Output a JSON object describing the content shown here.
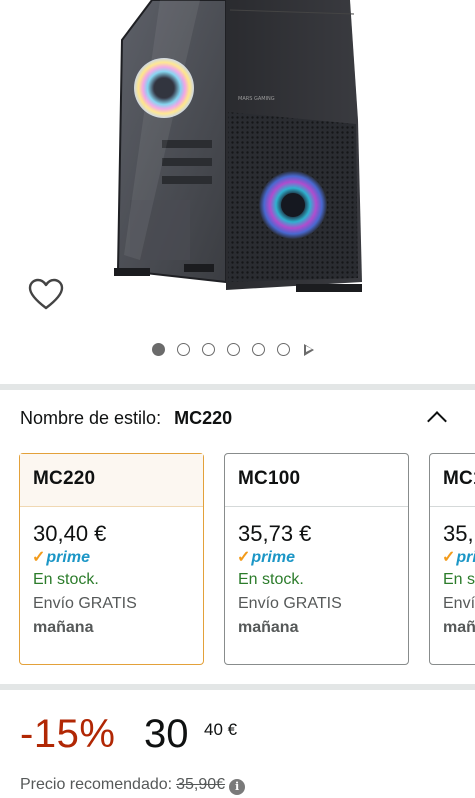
{
  "icons": {
    "wishlist": "heart-outline-icon",
    "collapse": "chevron-up-icon",
    "video": "play-icon",
    "info": "info-icon"
  },
  "colors": {
    "discount": "#B12704",
    "in_stock": "#2C7C2B",
    "prime_blue": "#1B96C6",
    "prime_check": "#F29B1B",
    "selected_border": "#E3A13A"
  },
  "gallery": {
    "image_count": 6,
    "active_index": 0,
    "has_video": true
  },
  "style_selector": {
    "label": "Nombre de estilo:",
    "selected": "MC220",
    "options": [
      {
        "name": "MC220",
        "price": "30,40 €",
        "prime": "prime",
        "stock": "En stock.",
        "shipping": "Envío GRATIS",
        "delivery": "mañana",
        "selected": true
      },
      {
        "name": "MC100",
        "price": "35,73 €",
        "prime": "prime",
        "stock": "En stock.",
        "shipping": "Envío GRATIS",
        "delivery": "mañana",
        "selected": false
      },
      {
        "name": "MC1",
        "price": "35,",
        "prime": "pri",
        "stock": "En st",
        "shipping": "Enví",
        "delivery": "maña",
        "selected": false
      }
    ]
  },
  "price": {
    "discount": "-15%",
    "whole": "30",
    "fraction": "40 €",
    "recommended_label": "Precio recomendado:",
    "recommended_value": "35,90€",
    "info_glyph": "i"
  }
}
